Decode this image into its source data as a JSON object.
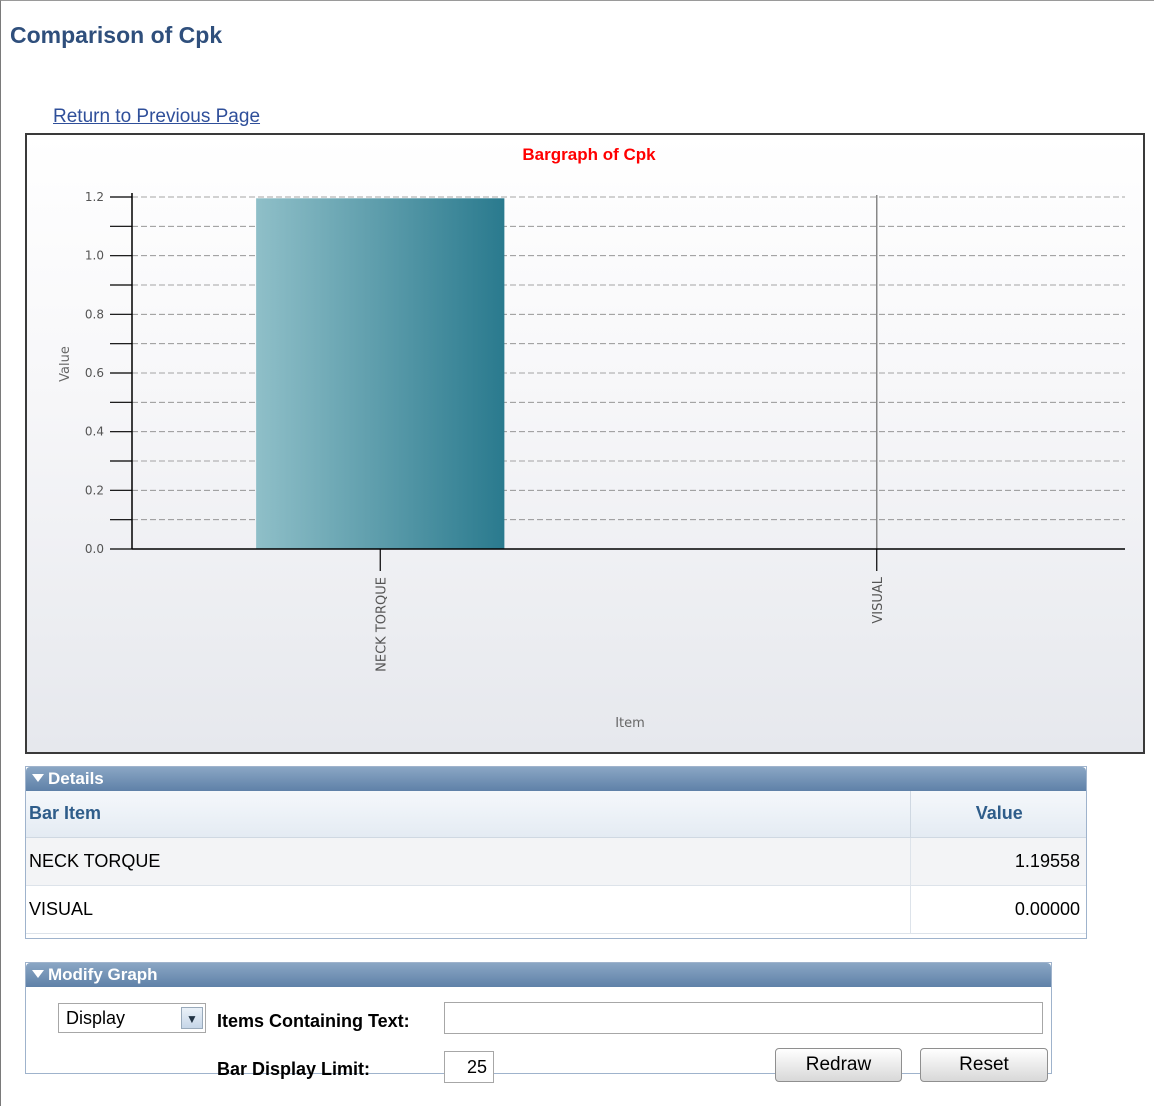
{
  "page": {
    "title": "Comparison of Cpk",
    "return_link": "Return to Previous Page"
  },
  "chart_data": {
    "type": "bar",
    "title": "Bargraph of Cpk",
    "xlabel": "Item",
    "ylabel": "Value",
    "categories": [
      "NECK TORQUE",
      "VISUAL"
    ],
    "values": [
      1.19558,
      0.0
    ],
    "ylim": [
      0,
      1.2
    ],
    "yticks": [
      "0.0",
      "0.2",
      "0.4",
      "0.6",
      "0.8",
      "1.0",
      "1.2"
    ],
    "grid": true,
    "bar_color_light": "#8fbfc8",
    "bar_color_dark": "#2a7a8e"
  },
  "details": {
    "header": "Details",
    "columns": [
      "Bar Item",
      "Value"
    ],
    "rows": [
      {
        "item": "NECK TORQUE",
        "value": "1.19558"
      },
      {
        "item": "VISUAL",
        "value": "0.00000"
      }
    ]
  },
  "modify": {
    "header": "Modify Graph",
    "display_select": "Display",
    "items_label": "Items Containing Text:",
    "items_value": "",
    "limit_label": "Bar Display Limit:",
    "limit_value": "25",
    "redraw_label": "Redraw",
    "reset_label": "Reset"
  },
  "colors": {
    "title": "#2f4f7c",
    "panel_header": "#6f8fb5",
    "chart_title": "#ff0000"
  }
}
